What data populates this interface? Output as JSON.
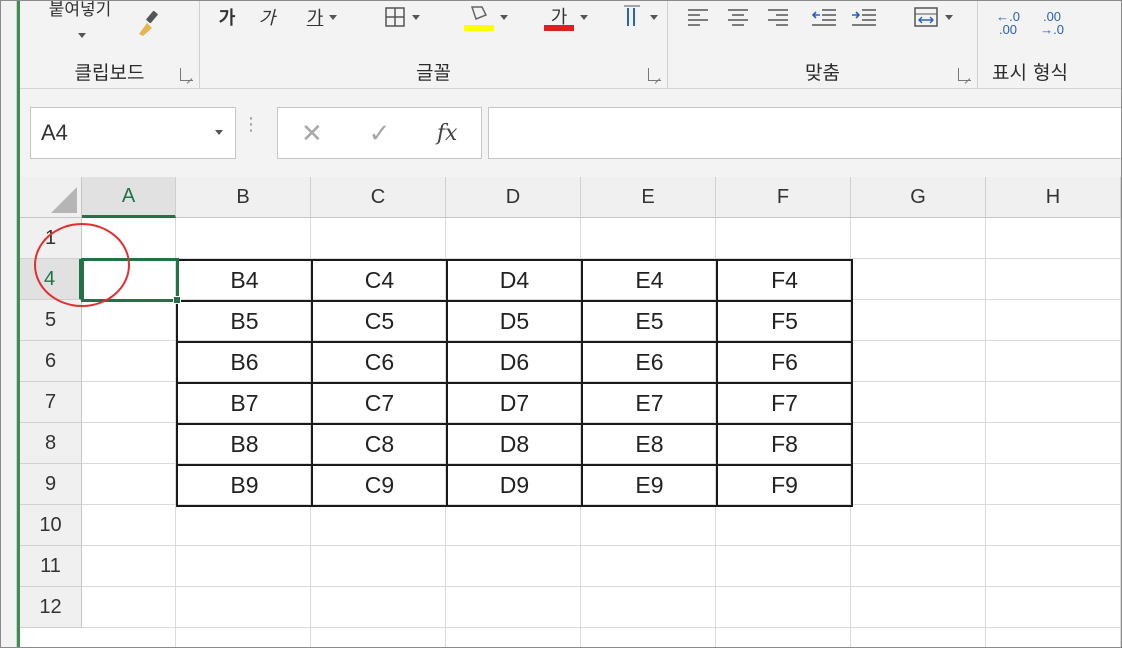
{
  "ribbon": {
    "clipboard": {
      "label": "클립보드",
      "paste_label": "붙여넣기"
    },
    "font": {
      "label": "글꼴",
      "bold": "가",
      "italic": "가",
      "underline": "가",
      "font_color_letter": "가"
    },
    "alignment": {
      "label": "맞춤"
    },
    "number": {
      "label": "표시 형식",
      "increase_decimal": "←.0 .00",
      "decrease_decimal": ".00 →.0"
    },
    "colors": {
      "fill": "#ffff00",
      "font": "#e02020"
    }
  },
  "formula_bar": {
    "name_box": "A4",
    "cancel": "✕",
    "enter": "✓",
    "fx": "fx",
    "value": ""
  },
  "columns": [
    "A",
    "B",
    "C",
    "D",
    "E",
    "F",
    "G",
    "H"
  ],
  "rows": [
    "1",
    "4",
    "5",
    "6",
    "7",
    "8",
    "9",
    "10",
    "11",
    "12"
  ],
  "active": {
    "column": "A",
    "row": "4"
  },
  "table": [
    [
      "B4",
      "C4",
      "D4",
      "E4",
      "F4"
    ],
    [
      "B5",
      "C5",
      "D5",
      "E5",
      "F5"
    ],
    [
      "B6",
      "C6",
      "D6",
      "E6",
      "F6"
    ],
    [
      "B7",
      "C7",
      "D7",
      "E7",
      "F7"
    ],
    [
      "B8",
      "C8",
      "D8",
      "E8",
      "F8"
    ],
    [
      "B9",
      "C9",
      "D9",
      "E9",
      "F9"
    ]
  ],
  "accent": "#217346",
  "annotation_color": "#e03030"
}
